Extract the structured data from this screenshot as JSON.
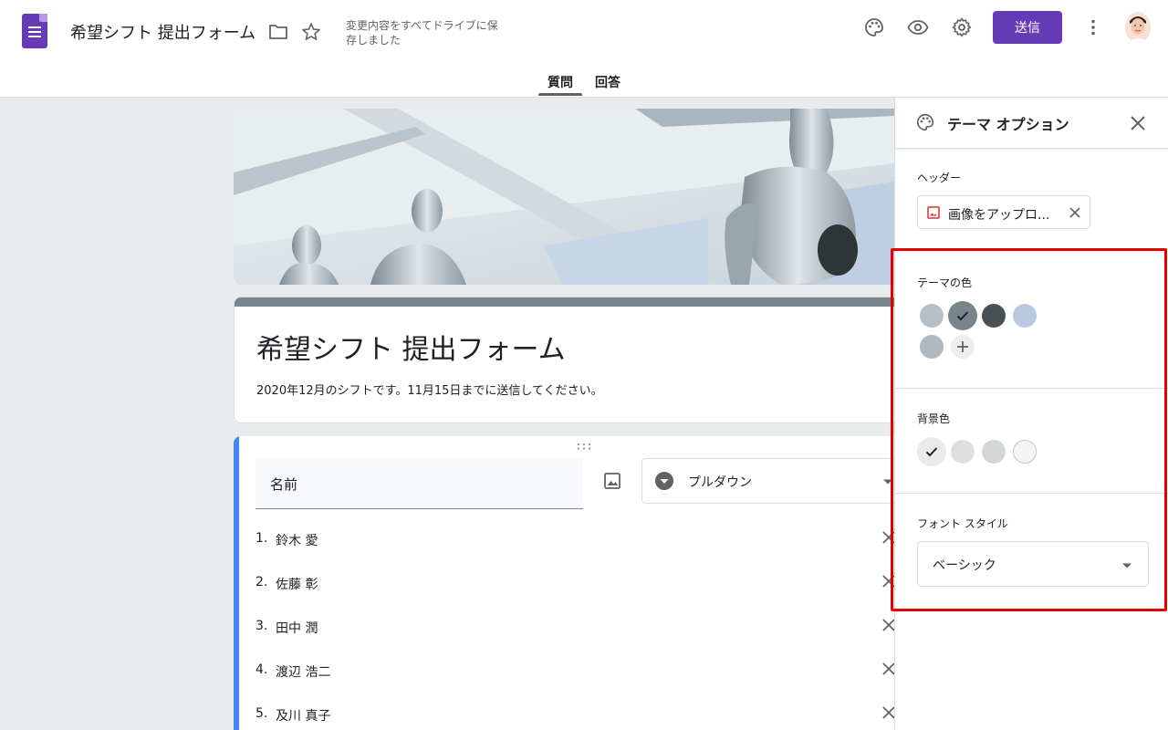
{
  "app": {
    "doc_title": "希望シフト 提出フォーム",
    "save_status": "変更内容をすべてドライブに保存しました",
    "send_label": "送信",
    "brand_color": "#673ab7"
  },
  "tabs": [
    {
      "label": "質問",
      "active": true
    },
    {
      "label": "回答",
      "active": false
    }
  ],
  "form": {
    "title": "希望シフト 提出フォーム",
    "description": "2020年12月のシフトです。11月15日までに送信してください。",
    "accent_color": "#78858d"
  },
  "question": {
    "title": "名前",
    "type_label": "プルダウン",
    "options": [
      {
        "num": "1.",
        "text": "鈴木 愛"
      },
      {
        "num": "2.",
        "text": "佐藤 彰"
      },
      {
        "num": "3.",
        "text": "田中 潤"
      },
      {
        "num": "4.",
        "text": "渡辺 浩二"
      },
      {
        "num": "5.",
        "text": "及川 真子"
      }
    ]
  },
  "theme_panel": {
    "title": "テーマ オプション",
    "header_label": "ヘッダー",
    "upload_label": "画像をアップロ...",
    "theme_color_label": "テーマの色",
    "theme_colors": [
      "#b5c0c7",
      "#78858d",
      "#4a5156",
      "#b8c9e0",
      "#aeb8bf"
    ],
    "selected_theme_color": "#78858d",
    "bg_color_label": "背景色",
    "bg_colors": [
      "#e8eaeb",
      "#dde0e2",
      "#d2d7da",
      "#f5f5f5"
    ],
    "selected_bg_color": "#e8eaeb",
    "font_style_label": "フォント スタイル",
    "font_style_value": "ベーシック"
  }
}
